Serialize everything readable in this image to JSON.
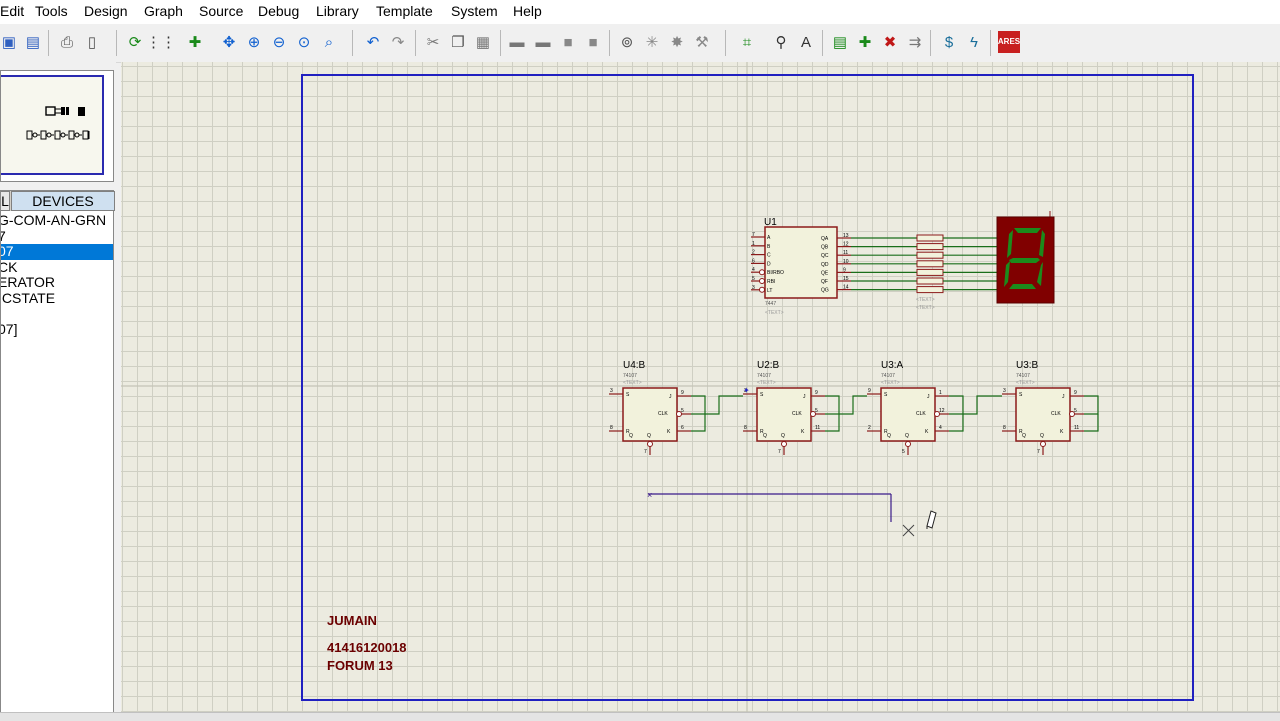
{
  "menu": [
    "Edit",
    "Tools",
    "Design",
    "Graph",
    "Source",
    "Debug",
    "Library",
    "Template",
    "System",
    "Help"
  ],
  "devices": {
    "tab_left": "L",
    "tab_label": "DEVICES",
    "items": [
      "G-COM-AN-GRN",
      "7",
      "07",
      "CK",
      "ERATOR",
      "ICSTATE",
      "",
      "07]"
    ],
    "selected_index": 2
  },
  "schematic": {
    "decoder": {
      "ref": "U1",
      "inputs": [
        "A",
        "B",
        "C",
        "D",
        "BI/RBO",
        "RBI",
        "LT"
      ],
      "outputs": [
        "QA",
        "QB",
        "QC",
        "QD",
        "QE",
        "QF",
        "QG"
      ],
      "in_pins": [
        "7",
        "1",
        "2",
        "6",
        "4",
        "5",
        "3"
      ],
      "out_pins": [
        "13",
        "12",
        "11",
        "10",
        "9",
        "15",
        "14"
      ],
      "part": "7447",
      "text": "<TEXT>"
    },
    "resistor_text": "<TEXT>",
    "flipflops": [
      {
        "ref": "U4:B",
        "part": "74107",
        "text": "<TEXT>",
        "pins": [
          "3",
          "2",
          "8",
          "9",
          "5",
          "6"
        ],
        "clr_pin": "7"
      },
      {
        "ref": "U2:B",
        "part": "74107",
        "text": "<TEXT>",
        "pins": [
          "3",
          "4",
          "8",
          "9",
          "5",
          "11"
        ],
        "clr_pin": "7"
      },
      {
        "ref": "U3:A",
        "part": "74107",
        "text": "<TEXT>",
        "pins": [
          "9",
          "3",
          "2",
          "1",
          "12",
          "4"
        ],
        "clr_pin": "5"
      },
      {
        "ref": "U3:B",
        "part": "74107",
        "text": "<TEXT>",
        "pins": [
          "3",
          "2",
          "8",
          "9",
          "5",
          "11"
        ],
        "clr_pin": "7"
      }
    ],
    "ff_labels": {
      "s": "S",
      "j": "J",
      "clk": "CLK",
      "k": "K",
      "r": "R",
      "q": "Q",
      "qbar": "Q"
    },
    "annotation": {
      "name": "JUMAIN",
      "id": "41416120018",
      "forum": "FORUM 13"
    }
  },
  "colors": {
    "wire": "#1a6e1a",
    "component_border": "#8b1a1a",
    "component_fill": "#f2f2dc",
    "pin": "#8b1a1a",
    "sheet_border": "#2020c0",
    "text_dark": "#6b0000",
    "seg_on": "#1c8a1c",
    "seg_bg": "#800000"
  },
  "icons": [
    "save-icon",
    "properties-icon",
    "print-icon",
    "page-icon",
    "refresh-icon",
    "grid-icon",
    "origin-icon",
    "pan-icon",
    "zoom-in-icon",
    "zoom-out-icon",
    "zoom-all-icon",
    "zoom-area-icon",
    "undo-icon",
    "redo-icon",
    "cut-icon",
    "copy-icon",
    "paste-icon",
    "block-copy-icon",
    "block-move-icon",
    "block-rotate-icon",
    "block-delete-icon",
    "pick-device-icon",
    "make-device-icon",
    "packaging-icon",
    "decompose-icon",
    "wire-autoroute-icon",
    "search-icon",
    "property-assign-icon",
    "new-sheet-icon",
    "add-sheet-icon",
    "remove-sheet-icon",
    "goto-sheet-icon",
    "bill-of-materials-icon",
    "electrical-check-icon",
    "ares-icon"
  ]
}
